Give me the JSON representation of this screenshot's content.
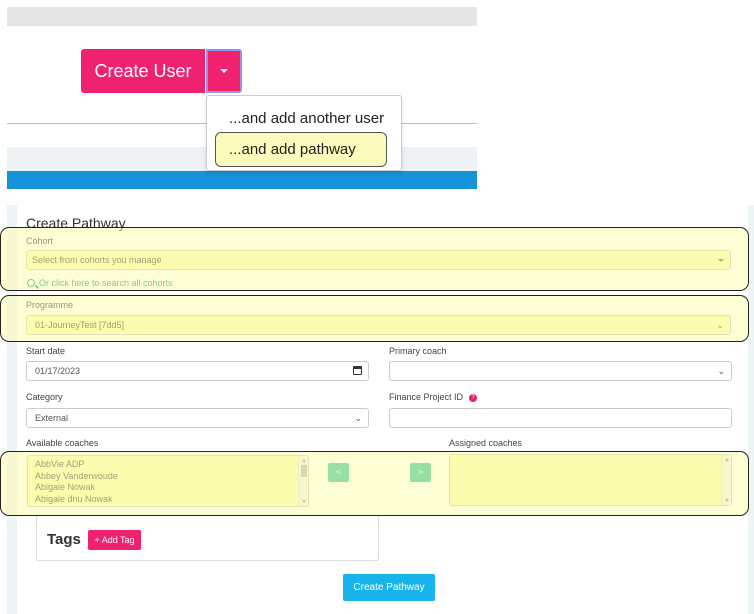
{
  "top_panel": {
    "create_user_label": "Create User",
    "dropdown_items": [
      "...and add another user",
      "...and add pathway"
    ],
    "highlighted_item": "...and add pathway"
  },
  "form": {
    "title": "Create Pathway",
    "cohort": {
      "label": "Cohort",
      "placeholder": "Select from cohorts you manage",
      "search_link": "Or click here to search all cohorts"
    },
    "programme": {
      "label": "Programme",
      "value": "01-JourneyTest [7dd5]"
    },
    "start_date": {
      "label": "Start date",
      "value": "01/17/2023"
    },
    "primary_coach": {
      "label": "Primary coach",
      "value": ""
    },
    "category": {
      "label": "Category",
      "value": "External"
    },
    "finance_project_id": {
      "label": "Finance Project ID",
      "value": "",
      "help_icon": "question-circle-icon"
    },
    "available_coaches": {
      "label": "Available coaches",
      "items": [
        "AbbVie ADP",
        "Abbey Vanderwoude",
        "Abigale Nowak",
        "Abigale dnu Nowak"
      ]
    },
    "assigned_coaches": {
      "label": "Assigned coaches",
      "items": []
    },
    "move_left_label": "<",
    "move_right_label": ">",
    "tags": {
      "label": "Tags",
      "add_label": "+ Add Tag"
    },
    "submit_label": "Create Pathway"
  },
  "colors": {
    "primary_pink": "#f0216e",
    "teal": "#44c7a7",
    "submit_blue": "#16b4ea",
    "band_blue": "#1592d8",
    "highlight_yellow": "#fbfbbb"
  }
}
